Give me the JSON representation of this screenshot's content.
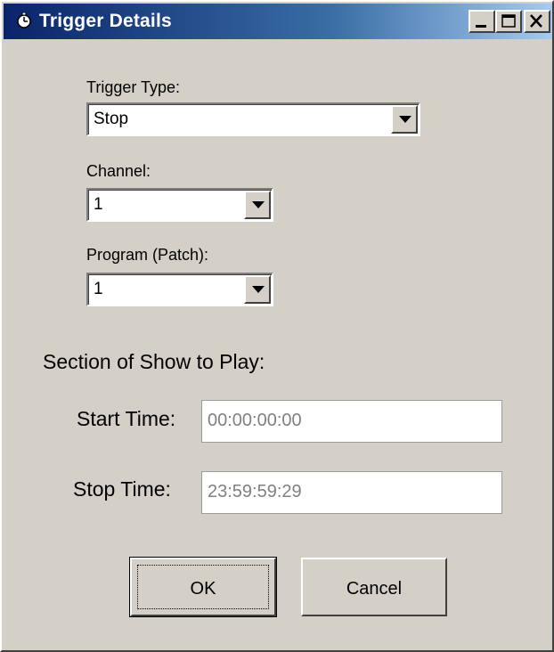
{
  "window": {
    "title": "Trigger Details",
    "icon": "trigger-app-icon",
    "buttons": {
      "minimize": "minimize-icon",
      "maximize": "maximize-icon",
      "close": "close-icon"
    },
    "colors": {
      "title_bar": "#0a246a",
      "face": "#d4d0c8"
    }
  },
  "trigger_type": {
    "label": "Trigger Type:",
    "value": "Stop"
  },
  "channel": {
    "label": "Channel:",
    "value": "1"
  },
  "program": {
    "label": "Program (Patch):",
    "value": "1"
  },
  "section": {
    "heading": "Section of Show to Play:",
    "start_label": "Start Time:",
    "start_value": "00:00:00:00",
    "stop_label": "Stop Time:",
    "stop_value": "23:59:59:29"
  },
  "actions": {
    "ok": "OK",
    "cancel": "Cancel"
  }
}
